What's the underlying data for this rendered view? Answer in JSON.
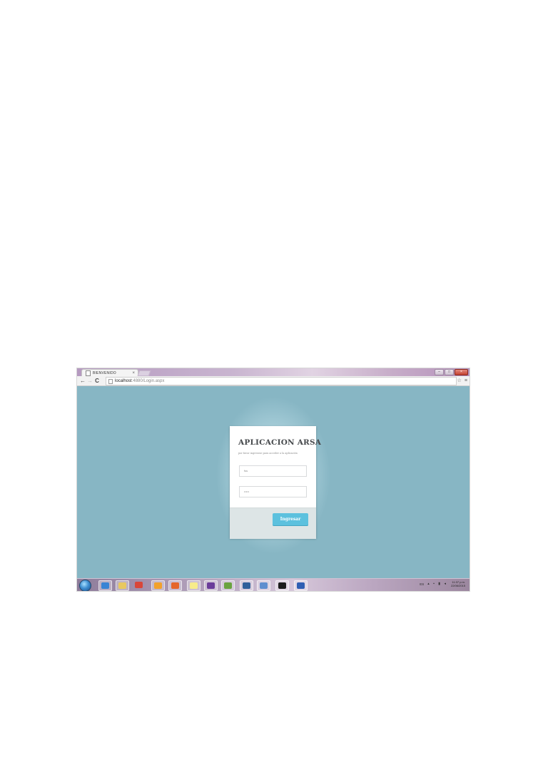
{
  "browser": {
    "tab_title": "BIENVENIDO",
    "tab_close": "×",
    "url_host": "localhost",
    "url_rest": ":4880/Login.aspx",
    "nav_back": "←",
    "nav_forward": "→",
    "nav_reload": "C",
    "star": "☆",
    "menu": "≡",
    "win_min": "–",
    "win_max": "□",
    "win_close": "×"
  },
  "login": {
    "title": "APLICACION ARSA",
    "subtitle": "por favor ingresese para acceder a la aplicación",
    "username_value": "fss",
    "password_value": "•••••",
    "submit_label": "Ingresar"
  },
  "colors": {
    "background": "#87b6c4",
    "button": "#5cc1de",
    "card_footer": "#dde5e6"
  },
  "taskbar": {
    "apps": [
      {
        "icon": "ie-icon",
        "color": "#3a84d4"
      },
      {
        "icon": "explorer-icon",
        "color": "#e8c860"
      },
      {
        "icon": "chrome-icon",
        "color": "#d9463a"
      },
      {
        "icon": "media-player-icon",
        "color": "#f2a12c"
      },
      {
        "icon": "firefox-icon",
        "color": "#e5662a"
      },
      {
        "icon": "sticky-notes-icon",
        "color": "#f7ec8a"
      },
      {
        "icon": "visual-studio-icon",
        "color": "#6b3d9a"
      },
      {
        "icon": "project-icon",
        "color": "#6aa33f"
      },
      {
        "icon": "sql-server-icon",
        "color": "#2f5f9a"
      },
      {
        "icon": "remote-desktop-icon",
        "color": "#5f8fcf"
      },
      {
        "icon": "cmd-icon",
        "color": "#1c1c1c"
      },
      {
        "icon": "word-icon",
        "color": "#2f5fb3"
      }
    ],
    "language": "ES",
    "time": "11:37 p.m.",
    "date": "22/06/2015"
  }
}
